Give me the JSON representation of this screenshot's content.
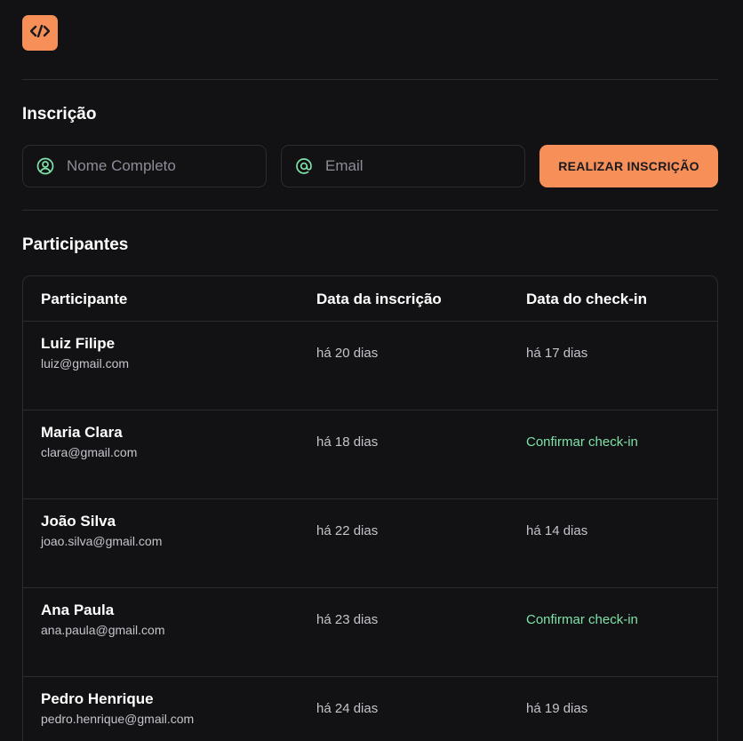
{
  "header": {
    "logo_icon": "code-icon",
    "logo_text": "</>",
    "accent_color": "#f78f58"
  },
  "registration": {
    "title": "Inscrição",
    "name_field": {
      "icon": "user-circle-icon",
      "placeholder": "Nome Completo",
      "value": ""
    },
    "email_field": {
      "icon": "at-sign-icon",
      "placeholder": "Email",
      "value": ""
    },
    "submit_label": "REALIZAR INSCRIÇÃO"
  },
  "participants": {
    "title": "Participantes",
    "columns": [
      "Participante",
      "Data da inscrição",
      "Data do check-in"
    ],
    "rows": [
      {
        "name": "Luiz Filipe",
        "email": "luiz@gmail.com",
        "registered": "há 20 dias",
        "checkin": "há 17 dias",
        "checkin_action": false
      },
      {
        "name": "Maria Clara",
        "email": "clara@gmail.com",
        "registered": "há 18 dias",
        "checkin": "Confirmar check-in",
        "checkin_action": true
      },
      {
        "name": "João Silva",
        "email": "joao.silva@gmail.com",
        "registered": "há 22 dias",
        "checkin": "há 14 dias",
        "checkin_action": false
      },
      {
        "name": "Ana Paula",
        "email": "ana.paula@gmail.com",
        "registered": "há 23 dias",
        "checkin": "Confirmar check-in",
        "checkin_action": true
      },
      {
        "name": "Pedro Henrique",
        "email": "pedro.henrique@gmail.com",
        "registered": "há 24 dias",
        "checkin": "há 19 dias",
        "checkin_action": false
      }
    ],
    "link_color": "#7ee2a8"
  }
}
